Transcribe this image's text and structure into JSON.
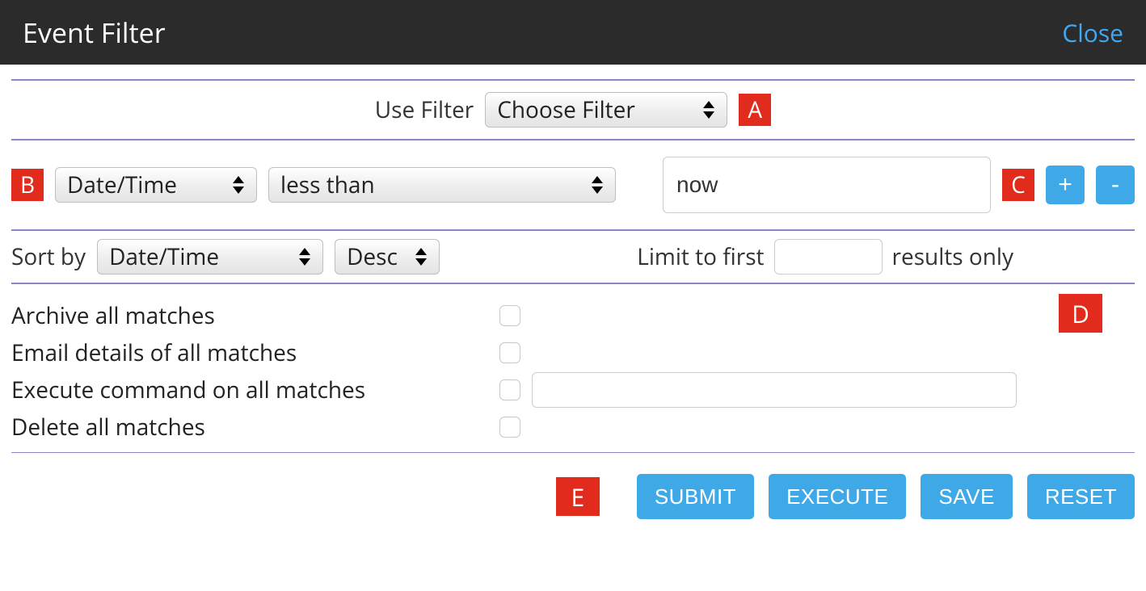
{
  "header": {
    "title": "Event Filter",
    "close_label": "Close"
  },
  "badges": {
    "a": "A",
    "b": "B",
    "c": "C",
    "d": "D",
    "e": "E"
  },
  "use_filter": {
    "label": "Use Filter",
    "selected": "Choose Filter"
  },
  "criteria": {
    "field_selected": "Date/Time",
    "operator_selected": "less than",
    "value": "now",
    "add_label": "+",
    "remove_label": "-"
  },
  "sort": {
    "label": "Sort by",
    "field_selected": "Date/Time",
    "direction_selected": "Desc"
  },
  "limit": {
    "prefix": "Limit to first",
    "value": "",
    "suffix": "results only"
  },
  "actions": {
    "archive_label": "Archive all matches",
    "email_label": "Email details of all matches",
    "execute_label": "Execute command on all matches",
    "execute_command": "",
    "delete_label": "Delete all matches"
  },
  "buttons": {
    "submit": "SUBMIT",
    "execute": "EXECUTE",
    "save": "SAVE",
    "reset": "RESET"
  }
}
